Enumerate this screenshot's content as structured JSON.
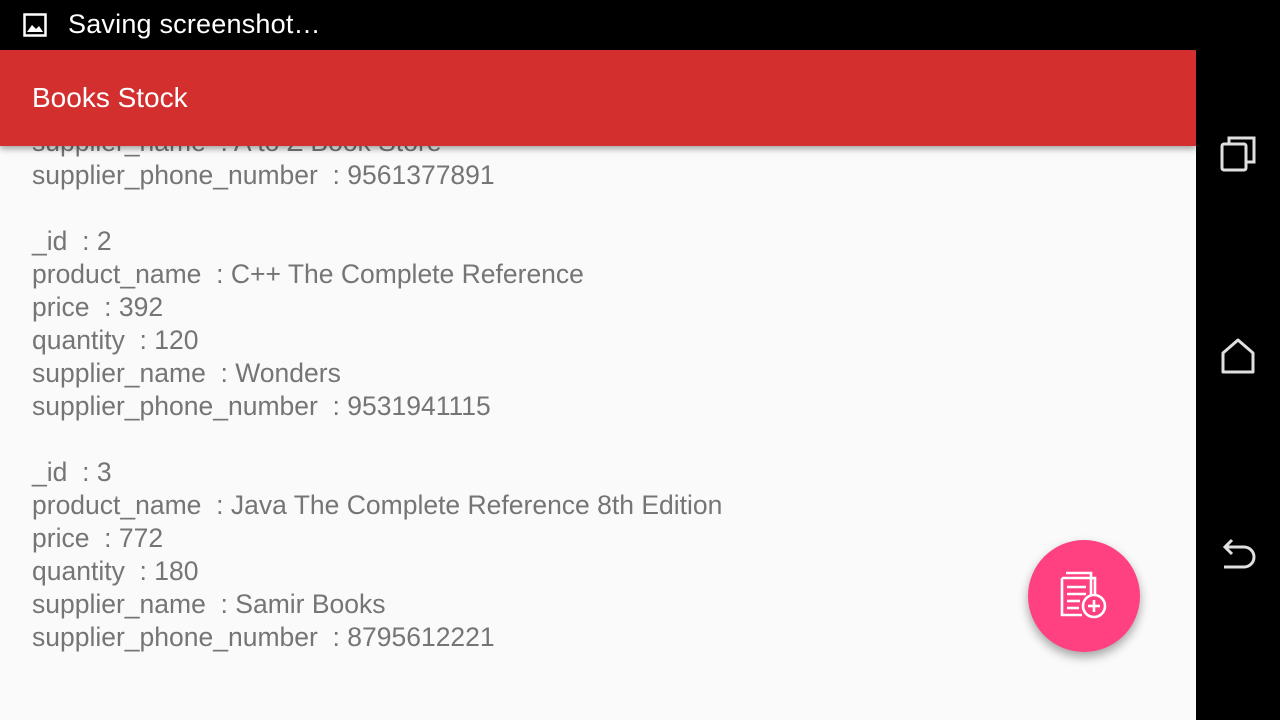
{
  "status_bar": {
    "notification_text": "Saving screenshot…",
    "icon": "image-icon"
  },
  "toolbar": {
    "title": "Books Stock"
  },
  "records": [
    {
      "lines": [
        "supplier_name  : A to Z Book Store",
        "supplier_phone_number  : 9561377891"
      ]
    },
    {
      "lines": [
        "_id  : 2",
        "product_name  : C++ The Complete Reference",
        "price  : 392",
        "quantity  : 120",
        "supplier_name  : Wonders",
        "supplier_phone_number  : 9531941115"
      ]
    },
    {
      "lines": [
        "_id  : 3",
        "product_name  : Java The Complete Reference 8th Edition",
        "price  : 772",
        "quantity  : 180",
        "supplier_name  : Samir Books",
        "supplier_phone_number  : 8795612221"
      ]
    }
  ],
  "fab": {
    "icon": "add-book-icon"
  },
  "nav": {
    "recents_icon": "recents-icon",
    "home_icon": "home-icon",
    "back_icon": "back-icon"
  },
  "colors": {
    "toolbar": "#d32f2f",
    "fab": "#ff4081",
    "text": "#757575",
    "background": "#fafafa"
  }
}
